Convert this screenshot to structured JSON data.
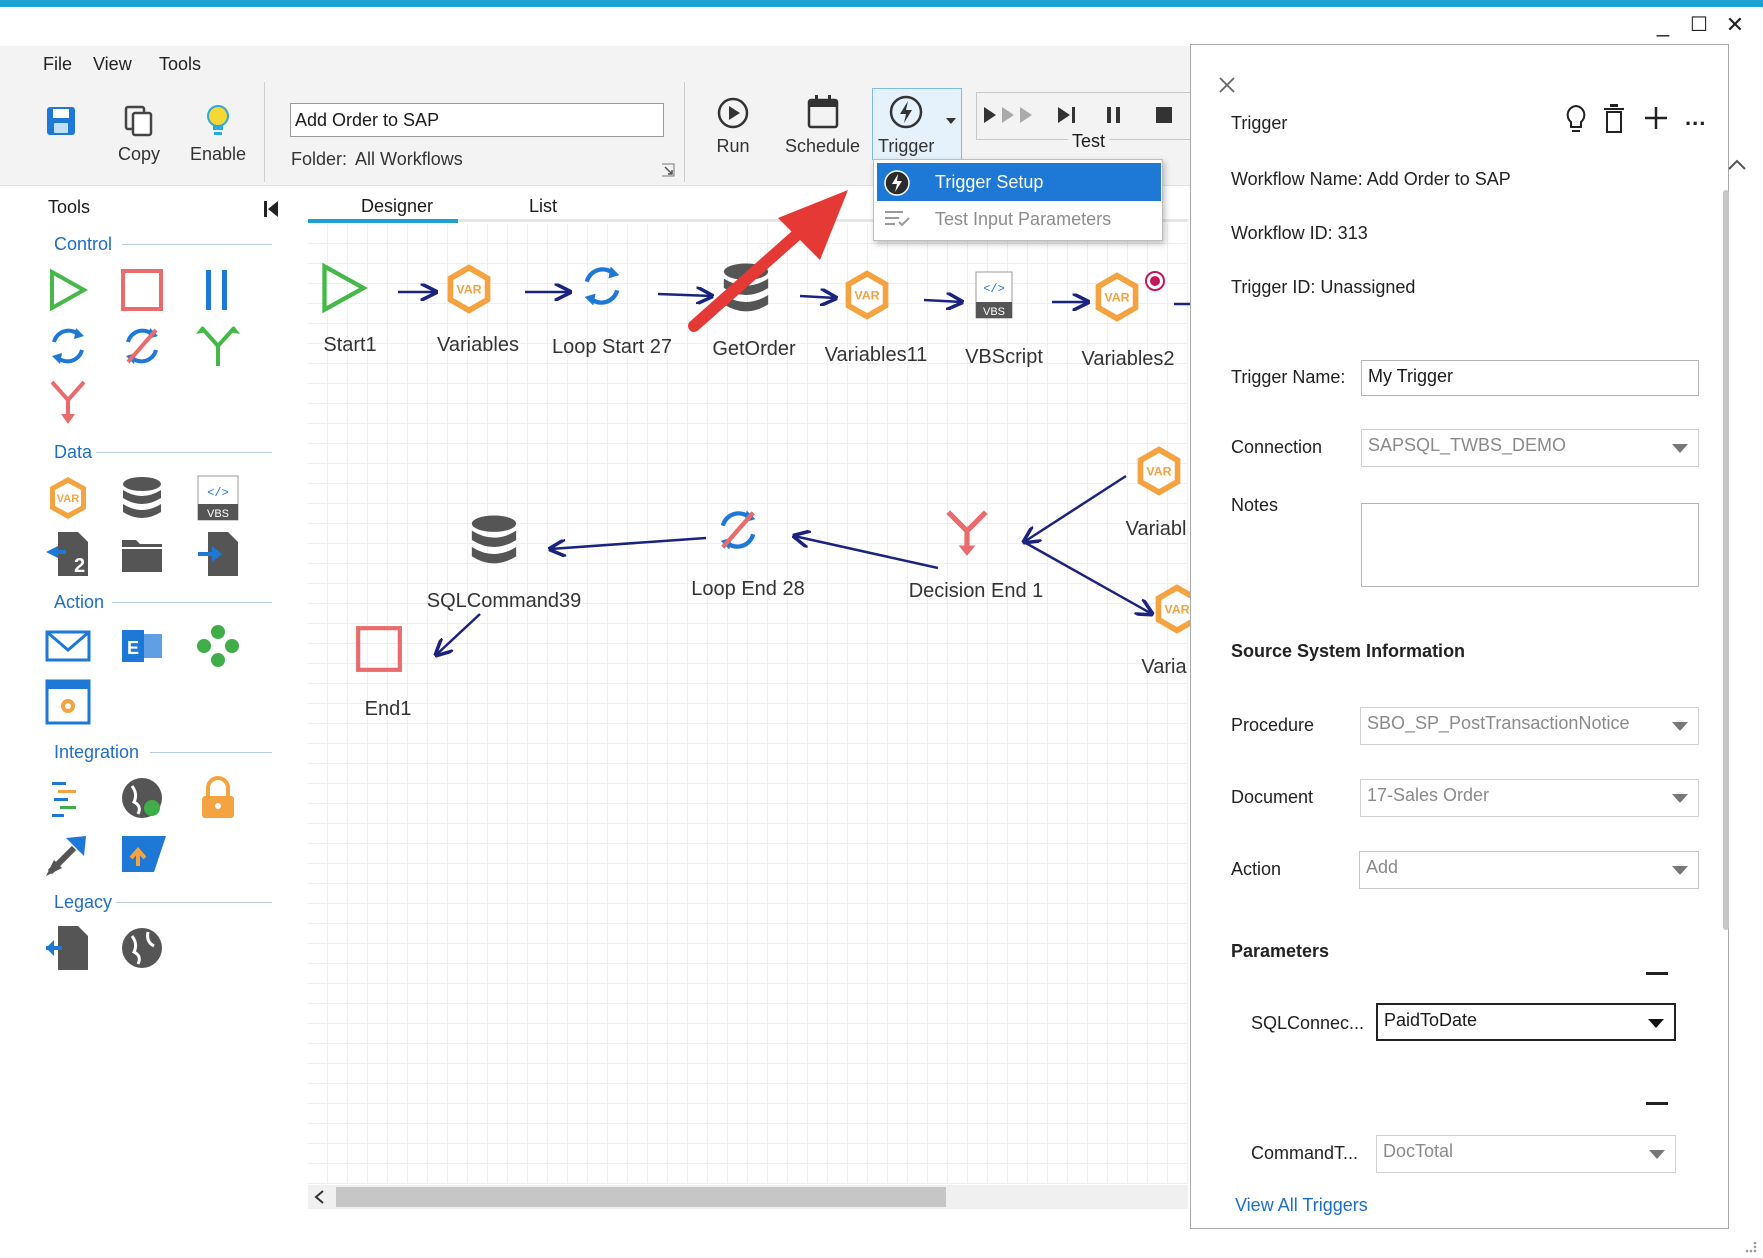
{
  "window": {
    "minimize_glyph": "_",
    "maximize_glyph": "☐",
    "close_glyph": "✕"
  },
  "menu": {
    "file": "File",
    "view": "View",
    "tools": "Tools"
  },
  "toolbar": {
    "save_icon": "save-icon",
    "copy_label": "Copy",
    "enable_label": "Enable",
    "workflow_name": "Add Order to SAP",
    "folder_label": "Folder:",
    "folder_value": "All Workflows",
    "run_label": "Run",
    "schedule_label": "Schedule",
    "trigger_label": "Trigger",
    "test_label": "Test"
  },
  "trigger_menu": {
    "items": [
      {
        "label": "Trigger Setup",
        "icon": "lightning-circle-icon",
        "selected": true
      },
      {
        "label": "Test Input Parameters",
        "icon": "list-check-icon",
        "disabled": true
      }
    ]
  },
  "tools_panel": {
    "title": "Tools",
    "sections": {
      "control": "Control",
      "data": "Data",
      "action": "Action",
      "integration": "Integration",
      "legacy": "Legacy"
    }
  },
  "tabs": {
    "designer": "Designer",
    "list": "List"
  },
  "nodes": {
    "start1": "Start1",
    "variables": "Variables",
    "loop_start": "Loop Start 27",
    "getorder": "GetOrder",
    "variables11": "Variables11",
    "vbscript": "VBScript",
    "variables2": "Variables2",
    "variable_partial": "Variabl",
    "varia_partial": "Varia",
    "decision_end": "Decision End 1",
    "loop_end": "Loop End 28",
    "sqlcommand": "SQLCommand39",
    "end1": "End1",
    "var_badge": "VAR",
    "vbs_badge": "VBS",
    "vbs_code": "</>"
  },
  "trigger_panel": {
    "title": "Trigger",
    "workflow_name": "Workflow Name: Add Order to SAP",
    "workflow_id": "Workflow ID: 313",
    "trigger_id": "Trigger ID: Unassigned",
    "trigger_name_label": "Trigger Name:",
    "trigger_name_value": "My Trigger",
    "connection_label": "Connection",
    "connection_value": "SAPSQL_TWBS_DEMO",
    "notes_label": "Notes",
    "source_header": "Source System Information",
    "procedure_label": "Procedure",
    "procedure_value": "SBO_SP_PostTransactionNotice",
    "document_label": "Document",
    "document_value": "17-Sales Order",
    "action_label": "Action",
    "action_value": "Add",
    "parameters_header": "Parameters",
    "param1_label": "SQLConnec...",
    "param1_value": "PaidToDate",
    "param2_label": "CommandT...",
    "param2_value": "DocTotal",
    "view_all": "View All Triggers",
    "more_glyph": "..."
  },
  "colors": {
    "accent": "#1ca1d2",
    "selection": "#1d78d6",
    "arrow": "#1a237e",
    "var_orange": "#f4a340",
    "stop_red": "#ea6b6b",
    "start_green": "#46b84a",
    "loop_blue": "#1d78d6",
    "callout_red": "#e53935"
  }
}
